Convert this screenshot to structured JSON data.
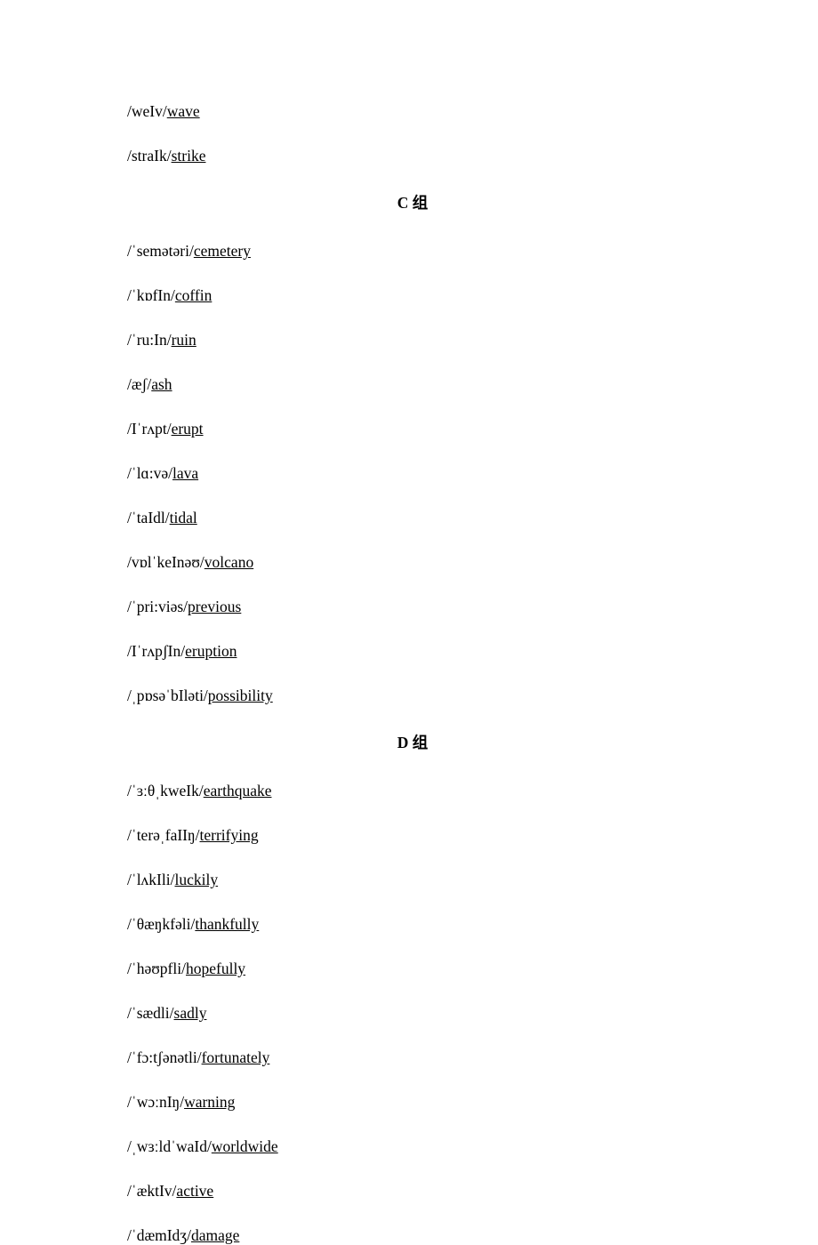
{
  "sections": [
    {
      "title": null,
      "entries": [
        {
          "ipa": "/weIv/",
          "word": "wave"
        },
        {
          "ipa": "/straIk/",
          "word": "strike"
        }
      ]
    },
    {
      "title": "C 组",
      "entries": [
        {
          "ipa": "/ˈsemətəri/",
          "word": "cemetery"
        },
        {
          "ipa": "/ˈkɒfIn/",
          "word": "coffin"
        },
        {
          "ipa": "/ˈru:In/",
          "word": "ruin"
        },
        {
          "ipa": "/æʃ/",
          "word": "ash"
        },
        {
          "ipa": "/Iˈrʌpt/",
          "word": "erupt"
        },
        {
          "ipa": "/ˈlɑ:və/",
          "word": "lava"
        },
        {
          "ipa": "/ˈtaIdl/",
          "word": "tidal"
        },
        {
          "ipa": "/vɒlˈkeInəʊ/",
          "word": "volcano"
        },
        {
          "ipa": "/ˈpri:viəs/",
          "word": "previous"
        },
        {
          "ipa": "/IˈrʌpʃIn/",
          "word": "eruption"
        },
        {
          "ipa": "/ˌpɒsəˈbIləti/",
          "word": "possibility"
        }
      ]
    },
    {
      "title": "D 组",
      "entries": [
        {
          "ipa": "/ˈɜːθˌkweIk/",
          "word": "earthquake"
        },
        {
          "ipa": "/ˈterəˌfaIIŋ/",
          "word": "terrifying"
        },
        {
          "ipa": "/ˈlʌkIli/",
          "word": "luckily"
        },
        {
          "ipa": "/ˈθæŋkfəli/",
          "word": "thankfully"
        },
        {
          "ipa": "/ˈhəʊpfli/",
          "word": "hopefully"
        },
        {
          "ipa": "/ˈsædli/",
          "word": "sadly"
        },
        {
          "ipa": "/ˈfɔ:tʃənətli/",
          "word": "fortunately"
        },
        {
          "ipa": "/ˈwɔːnIŋ/",
          "word": "warning"
        },
        {
          "ipa": "/ˌwɜːldˈwaId/",
          "word": "worldwide"
        },
        {
          "ipa": "/ˈæktIv/",
          "word": "active"
        },
        {
          "ipa": "/ˈdæmIdʒ/",
          "word": "damage"
        }
      ]
    }
  ]
}
